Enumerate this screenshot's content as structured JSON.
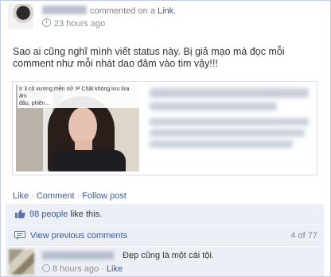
{
  "story": {
    "action_text": "commented on a",
    "link_label": "Link.",
    "time": "23 hours ago"
  },
  "status": {
    "text": "Sao ai cũng nghĩ mình viết status này. Bị giả mạo mà đọc mỗi comment như mỗi nhát dao đâm vào tim vậy!!!"
  },
  "shared_link": {
    "image_caption_line1": "Ir 3 cô xương mền nữ :P Chất khóng lưu lửa ẩm",
    "image_caption_line2": "đâu, phiền..."
  },
  "actions": {
    "like": "Like",
    "comment": "Comment",
    "follow": "Follow post",
    "separator": "·"
  },
  "likes": {
    "count_text": "98 people",
    "suffix": "like this."
  },
  "comments_nav": {
    "view_previous": "View previous comments",
    "counter": "4 of 77"
  },
  "comment": {
    "text": "Đẹp cũng là một cái tội.",
    "time": "8 hours ago",
    "like_label": "Like"
  },
  "colors": {
    "link": "#3b5998",
    "panel": "#eceff5",
    "border": "#c4cde0"
  }
}
